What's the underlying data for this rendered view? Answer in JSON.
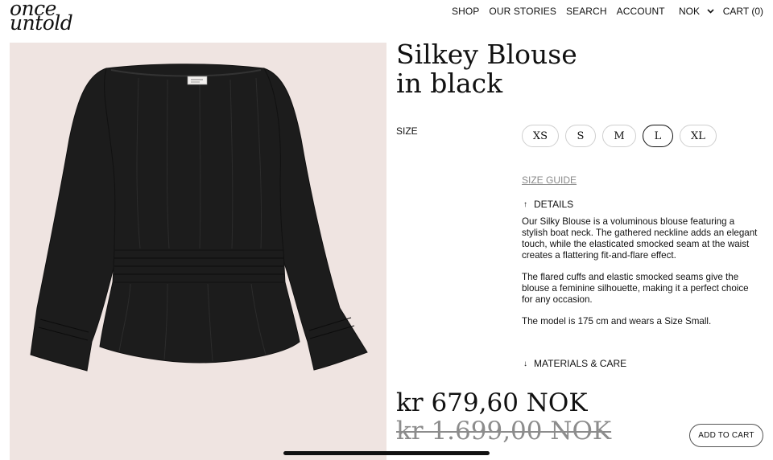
{
  "header": {
    "logo_line1": "once",
    "logo_line2": "untold",
    "nav": [
      "SHOP",
      "OUR STORIES",
      "SEARCH",
      "ACCOUNT"
    ],
    "currency": "NOK",
    "cart": "CART (0)"
  },
  "product": {
    "title_line1": "Silkey Blouse",
    "title_line2": "in black",
    "size_label": "SIZE",
    "sizes": [
      "XS",
      "S",
      "M",
      "L",
      "XL"
    ],
    "selected_size": "L",
    "size_guide": "SIZE GUIDE",
    "details_label": "DETAILS",
    "details_icon": "arrow-up-icon",
    "description": [
      "Our Silky Blouse is a voluminous blouse featuring a stylish boat neck. The gathered neckline adds an elegant touch, while the elasticated smocked seam at the waist creates a flattering fit-and-flare effect.",
      "The flared cuffs and elastic smocked seams give the blouse a feminine silhouette, making it a perfect choice for any occasion.",
      "The model is 175 cm and wears a Size Small."
    ],
    "materials_label": "MATERIALS & CARE",
    "materials_icon": "arrow-down-icon",
    "price_current": "kr 679,60 NOK",
    "price_original": "kr 1.699,00 NOK",
    "add_to_cart": "ADD TO CART"
  },
  "colors": {
    "image_background": "#efe4e1",
    "garment": "#1c1c1c",
    "text": "#111111",
    "muted": "#8c8c8c"
  }
}
